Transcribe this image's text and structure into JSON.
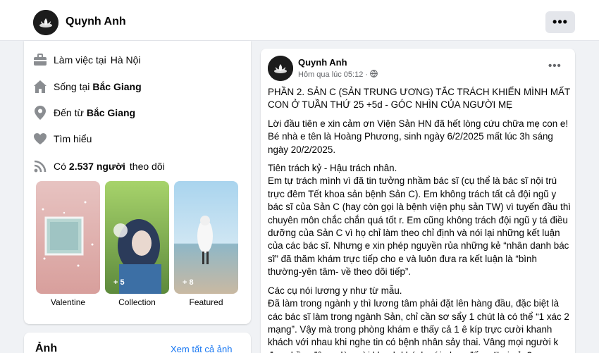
{
  "header": {
    "name": "Quynh Anh",
    "more_label": "•••"
  },
  "intro": {
    "work_prefix": "Làm việc tại",
    "work_place": "Hà Nội",
    "live_prefix": "Sống tại",
    "live_place": "Bắc Giang",
    "from_prefix": "Đến từ",
    "from_place": "Bắc Giang",
    "dating": "Tìm hiểu",
    "followers_prefix": "Có",
    "followers_count": "2.537 người",
    "followers_suffix": "theo dõi"
  },
  "featured": [
    {
      "label": "Valentine",
      "count": ""
    },
    {
      "label": "Collection",
      "count": "+ 5"
    },
    {
      "label": "Featured",
      "count": "+ 8"
    }
  ],
  "card2": {
    "title": "Ảnh",
    "link": "Xem tất cả ảnh"
  },
  "post": {
    "author": "Quynh Anh",
    "time": "Hôm qua lúc 05:12",
    "more_label": "•••",
    "paragraphs": [
      "PHẦN 2. SẢN C (SẢN TRUNG ƯƠNG) TẮC TRÁCH KHIẾN MÌNH MẤT CON Ở TUẦN THỨ 25 +5d - GÓC NHÌN CỦA NGƯỜI MẸ",
      "Lời đầu tiên e xin cảm ơn Viện Sản HN đã hết lòng cứu chữa mẹ con e! Bé nhà e tên là Hoàng Phương, sinh ngày 6/2/2025 mất lúc 3h sáng ngày 20/2/2025.",
      "Tiên trách kỷ - Hậu trách nhân.\nEm tự trách mình vì đã tin tưởng nhầm bác sĩ (cụ thể là bác sĩ nội trú trực đêm Tết khoa sản bệnh Sản C). Em không trách tất cả đội ngũ y bác sĩ của Sản C (hay còn gọi là bệnh viện phụ sản TW) vì tuyến đầu thì chuyên môn chắc chắn quá tốt r. Em cũng không trách đội ngũ y tá điều dưỡng của Sản C vì họ chỉ làm theo chỉ định và nói lại những kết luận của các bác sĩ. Nhưng e xin phép nguyền rủa những kẻ “nhân danh bác sĩ” đã thăm khám trực tiếp cho e và luôn đưa ra kết luận là “bình thường-yên tâm- về theo dõi tiếp”.",
      "Các cụ nói lương y như từ mẫu.\nĐã làm trong ngành y thì lương tâm phải đặt lên hàng đầu, đặc biệt là các bác sĩ làm trong ngành Sản, chỉ cần sơ sẩy 1 chút là có thể “1 xác 2 mạng”.  Vậy mà trong phòng khám e thấy cả 1 ê kíp trực cười khanh khách với nhau khi nghe tin có bệnh nhân sảy thai. Vâng mọi người k đọc nhầm đâu ạ, là cười khanh khách với nhau đấy ạ “Lại sảy?"
    ]
  }
}
